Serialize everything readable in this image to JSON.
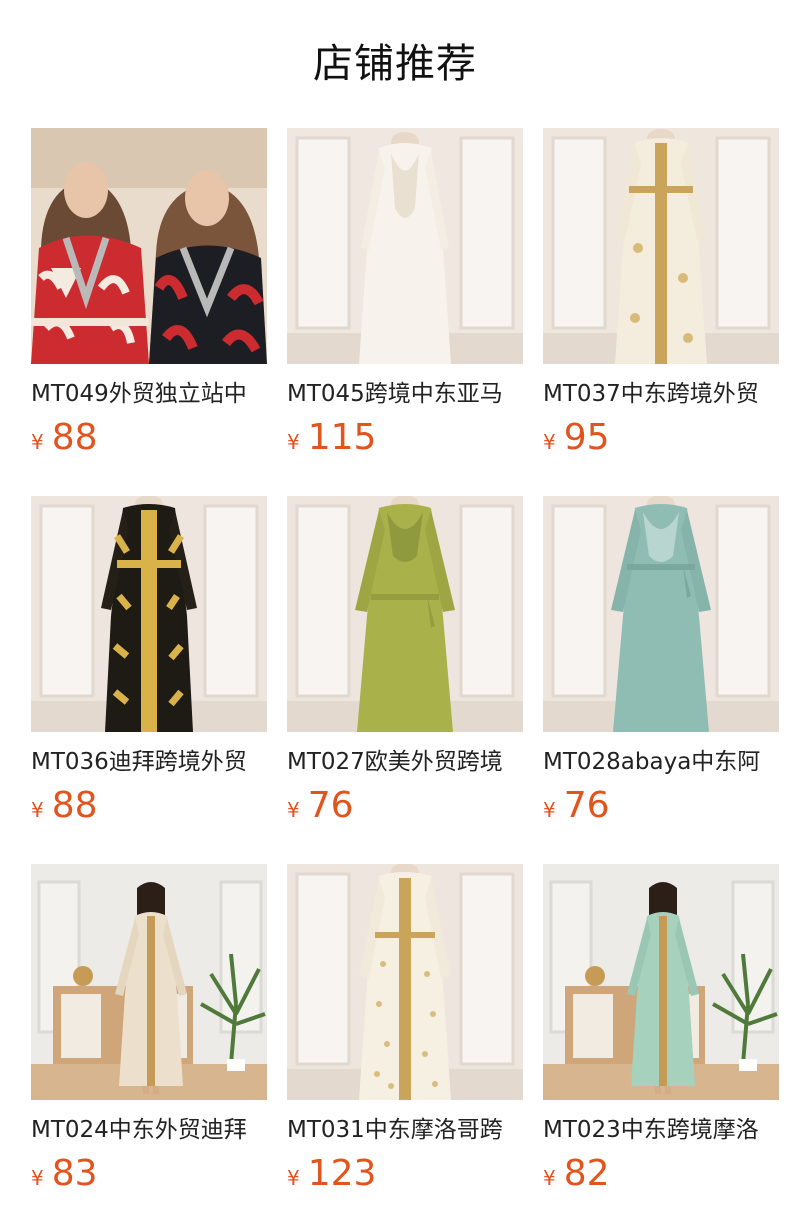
{
  "title": "店铺推荐",
  "products": [
    {
      "name": "MT049外贸独立站中",
      "currency": "¥",
      "price": "88",
      "image": "two-models-red-leaf-print-dress"
    },
    {
      "name": "MT045跨境中东亚马",
      "currency": "¥",
      "price": "115",
      "image": "white-embroidered-robe"
    },
    {
      "name": "MT037中东跨境外贸",
      "currency": "¥",
      "price": "95",
      "image": "cream-gold-trim-kaftan"
    },
    {
      "name": "MT036迪拜跨境外贸",
      "currency": "¥",
      "price": "88",
      "image": "black-gold-print-abaya"
    },
    {
      "name": "MT027欧美外贸跨境",
      "currency": "¥",
      "price": "76",
      "image": "olive-green-belted-dress"
    },
    {
      "name": "MT028abaya中东阿",
      "currency": "¥",
      "price": "76",
      "image": "sage-green-satin-dress"
    },
    {
      "name": "MT024中东外贸迪拜",
      "currency": "¥",
      "price": "83",
      "image": "model-beige-kaftan-interior"
    },
    {
      "name": "MT031中东摩洛哥跨",
      "currency": "¥",
      "price": "123",
      "image": "white-sequin-gold-kaftan"
    },
    {
      "name": "MT023中东跨境摩洛",
      "currency": "¥",
      "price": "82",
      "image": "model-mint-kaftan-interior"
    }
  ],
  "colors": {
    "price": "#e2541d",
    "text": "#222222",
    "title": "#111111"
  }
}
